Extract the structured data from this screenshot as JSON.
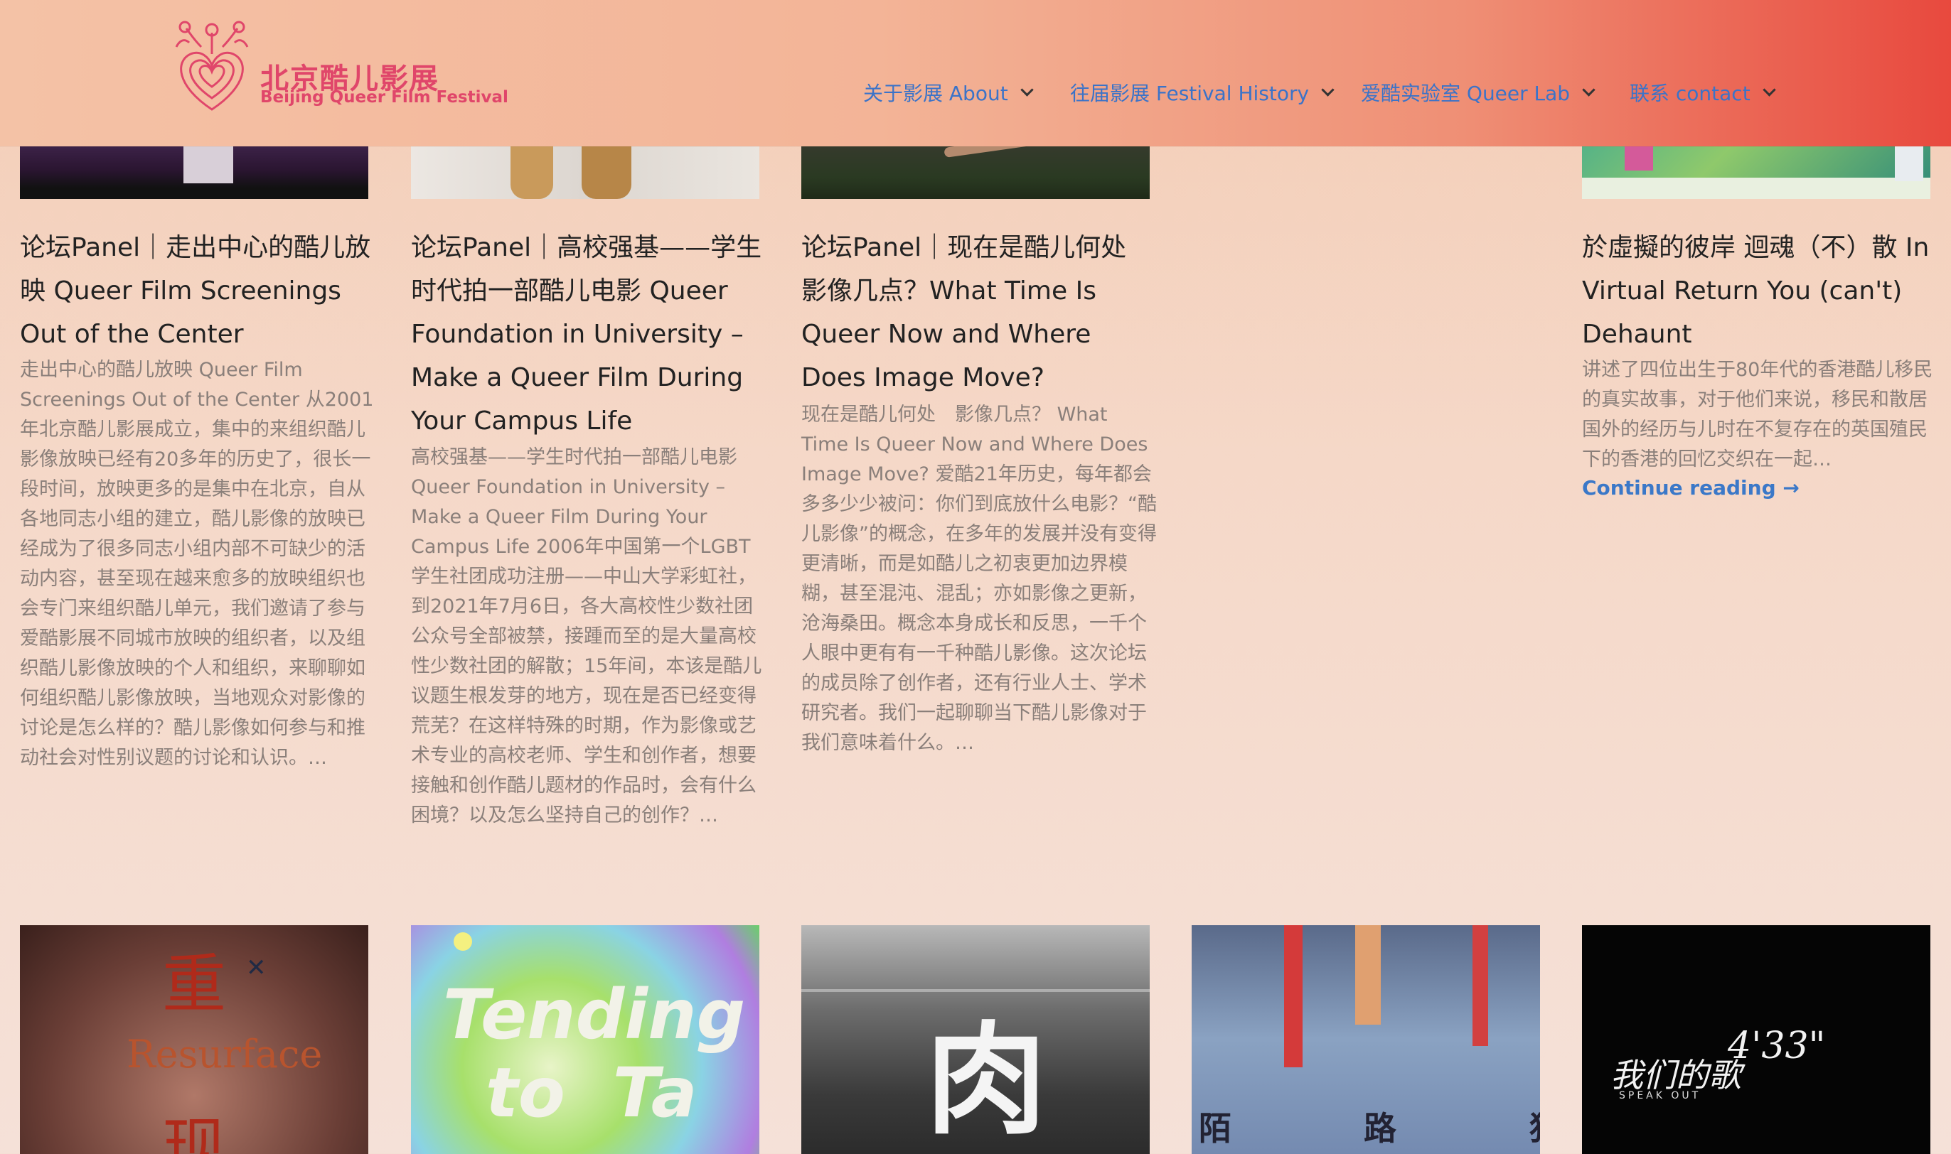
{
  "site": {
    "logo_cn": "北京酷儿影展",
    "logo_en": "Beijing Queer Film Festival"
  },
  "nav": [
    {
      "label": "关于影展 About"
    },
    {
      "label": "往届影展 Festival History"
    },
    {
      "label": "爱酷实验室 Queer Lab"
    },
    {
      "label": "联系 contact"
    }
  ],
  "posts": [
    {
      "title": "论坛Panel｜走出中心的酷儿放映 Queer Film Screenings Out of the Center",
      "excerpt": "走出中心的酷儿放映 Queer Film Screenings Out of the Center 从2001年北京酷儿影展成立，集中的来组织酷儿影像放映已经有20多年的历史了，很长一段时间，放映更多的是集中在北京，自从各地同志小组的建立，酷儿影像的放映已经成为了很多同志小组内部不可缺少的活动内容，甚至现在越来愈多的放映组织也会专门来组织酷儿单元，我们邀请了参与爱酷影展不同城市放映的组织者，以及组织酷儿影像放映的个人和组织，来聊聊如何组织酷儿影像放映，当地观众对影像的讨论是怎么样的？酷儿影像如何参与和推动社会对性别议题的讨论和认识。…"
    },
    {
      "title": "论坛Panel｜高校强基——学生时代拍一部酷儿电影 Queer Foundation in University – Make a Queer Film During Your Campus Life",
      "excerpt": "高校强基——学生时代拍一部酷儿电影 Queer Foundation in University – Make a Queer Film During Your Campus Life 2006年中国第一个LGBT学生社团成功注册——中山大学彩虹社，到2021年7月6日，各大高校性少数社团公众号全部被禁，接踵而至的是大量高校性少数社团的解散；15年间，本该是酷儿议题生根发芽的地方，现在是否已经变得荒芜？在这样特殊的时期，作为影像或艺术专业的高校老师、学生和创作者，想要接触和创作酷儿题材的作品时，会有什么困境？以及怎么坚持自己的创作？…"
    },
    {
      "title": "论坛Panel｜现在是酷儿何处影像几点？What Time Is Queer Now and Where Does Image Move?",
      "excerpt": "现在是酷儿何处　影像几点？ What Time Is Queer Now and Where Does Image Move? 爱酷21年历史，每年都会多多少少被问：你们到底放什么电影？“酷儿影像”的概念，在多年的发展并没有变得更清晰，而是如酷儿之初衷更加边界模糊，甚至混沌、混乱；亦如影像之更新，沧海桑田。概念本身成长和反思，一千个人眼中更有有一千种酷儿影像。这次论坛的成员除了创作者，还有行业人士、学术研究者。我们一起聊聊当下酷儿影像对于我们意味着什么。…"
    },
    {
      "title": "於虛擬的彼岸 迴魂（不）散 In Virtual Return You (can't) Dehaunt",
      "excerpt": "讲述了四位出生于80年代的香港酷儿移民的真实故事，对于他们来说，移民和散居国外的经历与儿时在不复存在的英国殖民下的香港的回忆交织在一起…",
      "continue": "Continue reading →"
    }
  ],
  "thumbnails_row2": [
    {
      "text_cn": "重 现",
      "text_en": "Resurface"
    },
    {
      "text": "Tending to Ta"
    },
    {
      "text": "肉"
    },
    {
      "text": "陌　路　狂　欢"
    },
    {
      "text_cn": "我们的歌",
      "text_num": "4'33\"",
      "text_en": "SPEAK OUT"
    }
  ],
  "colors": {
    "nav_link": "#3b73c8",
    "logo": "#e0466a",
    "title": "#222222",
    "excerpt": "#8a7f7a",
    "continue": "#3b78c8"
  }
}
